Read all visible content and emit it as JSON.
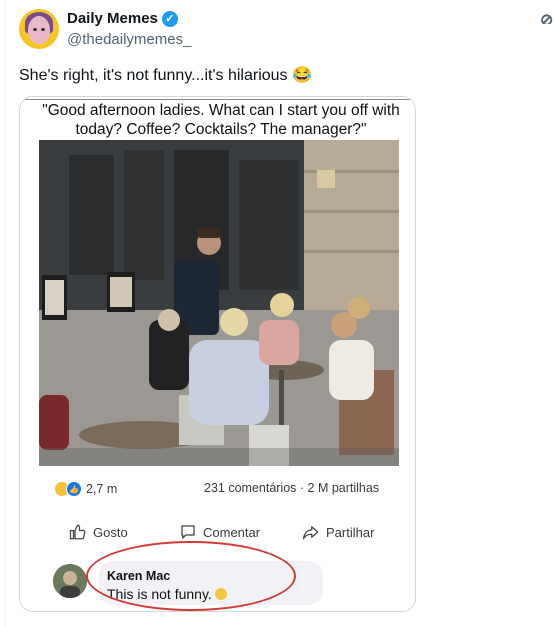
{
  "tweet": {
    "author_name": "Daily Memes",
    "handle": "@thedailymemes_",
    "text": "She's right, it's not funny...it's hilarious 😂"
  },
  "post": {
    "caption": "\"Good afternoon ladies. What can I start you off with today? Coffee? Cocktails? The manager?\"",
    "reactions_count": "2,7 m",
    "stats": "231 comentários · 2 M partilhas",
    "actions": {
      "like": "Gosto",
      "comment": "Comentar",
      "share": "Partilhar"
    },
    "comment": {
      "author": "Karen Mac",
      "text": "This is not funny."
    }
  },
  "colors": {
    "verified": "#1d9bf0",
    "highlight_oval": "#d43a3a",
    "like_blue": "#1877f2"
  },
  "icons": [
    "verified-badge-icon",
    "more-icon",
    "haha-reaction-icon",
    "like-reaction-icon",
    "thumbs-up-icon",
    "comment-icon",
    "share-icon",
    "sad-emoji-icon"
  ]
}
